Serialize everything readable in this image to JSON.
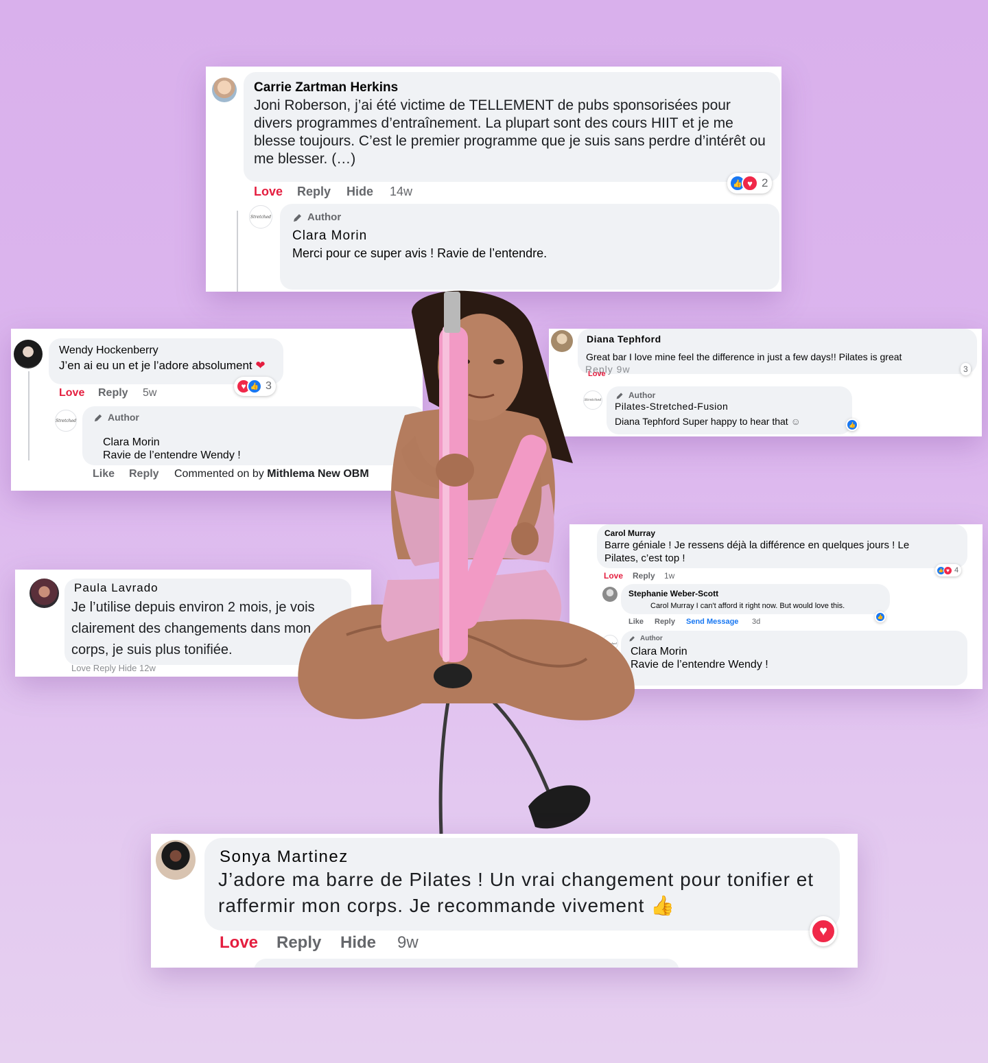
{
  "reactions": {
    "like": "👍",
    "love": "♥"
  },
  "icons": {
    "pencil": "pencil-icon",
    "smile": "☺"
  },
  "card1": {
    "name": "Carrie Zartman Herkins",
    "text": "Joni Roberson, j’ai été victime de TELLEMENT de pubs sponsorisées pour divers programmes d’entraînement. La plupart sont des cours HIIT et je me blesse toujours. C’est le premier programme que je suis sans perdre d’intérêt ou me blesser. (…)",
    "actions": {
      "love": "Love",
      "reply": "Reply",
      "hide": "Hide",
      "time": "14w"
    },
    "reactions": "2",
    "reply": {
      "badge": "Author",
      "logo": "Stretched",
      "name": "Clara Morin",
      "text": "Merci pour ce super avis ! Ravie de l’entendre."
    }
  },
  "card2": {
    "name": "Wendy Hockenberry",
    "text": "J’en ai eu un et je l’adore absolument",
    "heart": "❤",
    "actions": {
      "love": "Love",
      "reply": "Reply",
      "time": "5w"
    },
    "reactions": "3",
    "reply": {
      "badge": "Author",
      "logo": "Stretched",
      "name": "Clara Morin",
      "text": "Ravie de l’entendre Wendy !"
    },
    "footer": {
      "like": "Like",
      "reply": "Reply",
      "commented": "Commented on by",
      "by": "Mithlema New OBM"
    }
  },
  "card3": {
    "name": "Diana Tephford",
    "text": "Great bar I love mine feel the difference in just a few days!! Pilates is great",
    "actions_ghost": "Reply  9w",
    "love": "Love",
    "reactions": "3",
    "reply": {
      "badge": "Author",
      "logo": "Stretched",
      "name": "Pilates-Stretched-Fusion",
      "text": "Diana Tephford Super happy to hear that"
    }
  },
  "card4": {
    "name": "Paula Lavrado",
    "text": "Je l’utilise depuis environ 2 mois, je vois clairement des changements dans mon corps, je suis plus tonifiée.",
    "actions": "Love Reply Hide 12w"
  },
  "card5": {
    "name": "Carol Murray",
    "text": "Barre géniale ! Je ressens déjà la différence en quelques jours ! Le Pilates, c’est top !",
    "actions": {
      "love": "Love",
      "reply": "Reply",
      "time": "1w"
    },
    "reactions": "4",
    "reply1": {
      "name": "Stephanie Weber-Scott",
      "text": "Carol Murray I can't afford it right now. But would love this.",
      "like": "Like",
      "reply": "Reply",
      "send": "Send Message",
      "time": "3d"
    },
    "reply2": {
      "badge": "Author",
      "logo": "Stretched",
      "name": "Clara Morin",
      "text": "Ravie de l’entendre Wendy !"
    }
  },
  "card6": {
    "name": "Sonya Martinez",
    "text": "J’adore ma barre de Pilates ! Un vrai changement pour tonifier et raffermir mon corps. Je recommande vivement",
    "actions": {
      "love": "Love",
      "reply": "Reply",
      "hide": "Hide",
      "time": "9w"
    }
  }
}
